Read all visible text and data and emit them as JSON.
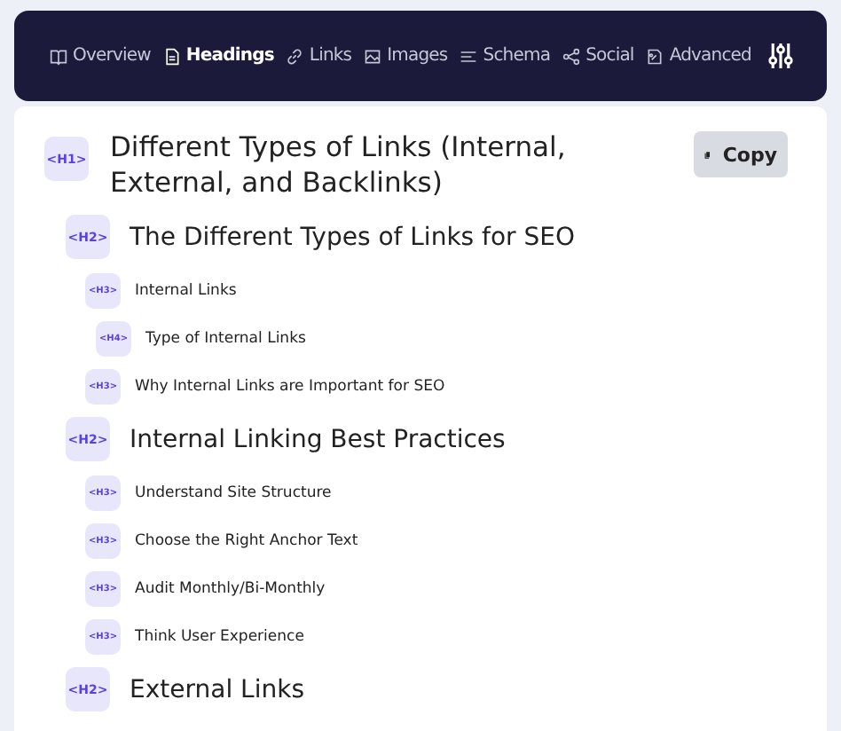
{
  "tabs": [
    {
      "label": "Overview",
      "kind": "book",
      "selected": false
    },
    {
      "label": "Headings",
      "kind": "doc",
      "selected": true
    },
    {
      "label": "Links",
      "kind": "link",
      "selected": false
    },
    {
      "label": "Images",
      "kind": "image",
      "selected": false
    },
    {
      "label": "Schema",
      "kind": "lines",
      "selected": false
    },
    {
      "label": "Social",
      "kind": "share",
      "selected": false
    },
    {
      "label": "Advanced",
      "kind": "advanced",
      "selected": false
    }
  ],
  "copy_button": "Copy",
  "headings": [
    {
      "tag": "<H1>",
      "text": "Different Types of Links (Internal, External, and Backlinks)",
      "children": [
        {
          "tag": "<H2>",
          "text": "The Different Types of Links for SEO",
          "children": [
            {
              "tag": "<H3>",
              "text": "Internal Links",
              "children": [
                {
                  "tag": "<H4>",
                  "text": "Type of Internal Links"
                }
              ]
            },
            {
              "tag": "<H3>",
              "text": "Why Internal Links are Important for SEO"
            }
          ]
        },
        {
          "tag": "<H2>",
          "text": "Internal Linking Best Practices",
          "children": [
            {
              "tag": "<H3>",
              "text": "Understand Site Structure"
            },
            {
              "tag": "<H3>",
              "text": "Choose the Right Anchor Text"
            },
            {
              "tag": "<H3>",
              "text": "Audit Monthly/Bi-Monthly"
            },
            {
              "tag": "<H3>",
              "text": "Think User Experience"
            }
          ]
        },
        {
          "tag": "<H2>",
          "text": "External Links"
        }
      ]
    }
  ]
}
